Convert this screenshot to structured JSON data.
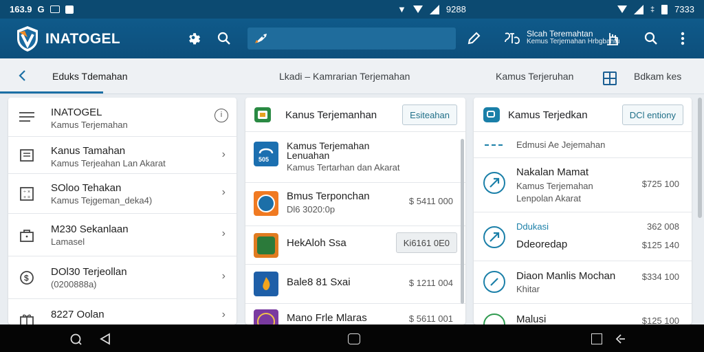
{
  "status_bar": {
    "left_text": "163.9",
    "left_glyph": "G",
    "center_time": "9288",
    "right_time": "7333",
    "right_glyph": "‡"
  },
  "app_bar": {
    "brand": "INATOGEL",
    "search_value": "",
    "account_title": "Slcah Teremahtan",
    "account_subtitle": "Kemus Terjemahan Hrbgbahtu"
  },
  "tabs": [
    {
      "label": "Eduks Tdemahan",
      "active": true
    },
    {
      "label": "Lkadi – Kamrarian Terjemahan",
      "active": false
    },
    {
      "label": "Kamus Terjeruhan",
      "active": false
    },
    {
      "label": "Bdkam kes",
      "active": false
    }
  ],
  "left_panel": {
    "items": [
      {
        "title": "INATOGEL",
        "subtitle": "Kamus Terjemahan",
        "icon": "menu-icon",
        "trailing": "info-icon"
      },
      {
        "title": "Kanus Tamahan",
        "subtitle": "Kamus Terjeahan Lan Akarat",
        "icon": "document-icon",
        "trailing": "chevron-right-icon"
      },
      {
        "title": "SOloo Tehakan",
        "subtitle": "Kamus Tejgeman_deka4)",
        "icon": "calculator-icon",
        "trailing": "chevron-right-icon"
      },
      {
        "title": "M230 Sekanlaan",
        "subtitle": "Lamasel",
        "icon": "bag-icon",
        "trailing": "chevron-right-icon"
      },
      {
        "title": "DOl30 Terjeollan",
        "subtitle": "(0200888a)",
        "icon": "coin-icon",
        "trailing": "chevron-right-icon"
      },
      {
        "title": "8227 Oolan",
        "subtitle": "",
        "icon": "gift-icon",
        "trailing": "chevron-right-icon"
      }
    ]
  },
  "middle_panel": {
    "title": "Kanus Terjemanhan",
    "action": "Esiteahan",
    "items": [
      {
        "title": "Kamus Terjemahan",
        "title2": "Lenuahan",
        "subtitle": "Kamus Tertarhan dan Akarat",
        "badge": "505",
        "price": ""
      },
      {
        "title": "Bmus Terponchan",
        "subtitle": "Dl6 3020:0p",
        "price": "$ 5411 000"
      },
      {
        "title": "HekAloh Ssa",
        "subtitle": "",
        "price": "Ki6161 0E0"
      },
      {
        "title": "Bale8 81 Sxai",
        "subtitle": "",
        "price": "$ 1211 004"
      },
      {
        "title": "Mano Frle Mlaras",
        "subtitle": "",
        "price": "$ 5611 001"
      }
    ]
  },
  "right_panel": {
    "title": "Kamus Terjedkan",
    "action": "DCl entiony",
    "header_row": "Edmusi Ae Jejemahan",
    "items": [
      {
        "title": "Nakalan Mamat",
        "subtitle": "Kamus Terjemahan",
        "subtitle2": "Lenpolan Akarat",
        "price": "$725 100"
      },
      {
        "label": "Ddukasi",
        "label_price": "362 008",
        "title": "Ddeoredap",
        "price": "$125 140"
      },
      {
        "title": "Diaon Manlis Mochan",
        "subtitle": "Khitar",
        "price": "$334 100"
      },
      {
        "title": "Malusi",
        "price": "$125 100"
      }
    ]
  },
  "colors": {
    "primary": "#0d4f7c",
    "accent": "#1a7fa8",
    "navbar": "#050505"
  }
}
